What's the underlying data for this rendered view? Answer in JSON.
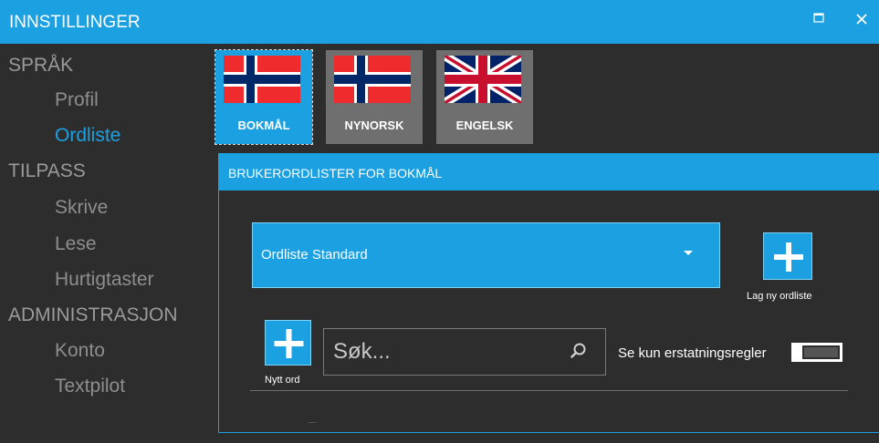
{
  "window": {
    "title": "INNSTILLINGER",
    "controls": [
      "maximize-icon",
      "close-icon"
    ]
  },
  "sidebar": {
    "sections": [
      {
        "label": "SPRÅK",
        "items": [
          {
            "label": "Profil",
            "active": false
          },
          {
            "label": "Ordliste",
            "active": true
          }
        ]
      },
      {
        "label": "TILPASS",
        "items": [
          {
            "label": "Skrive",
            "active": false
          },
          {
            "label": "Lese",
            "active": false
          },
          {
            "label": "Hurtigtaster",
            "active": false
          }
        ]
      },
      {
        "label": "ADMINISTRASJON",
        "items": [
          {
            "label": "Konto",
            "active": false
          },
          {
            "label": "Textpilot",
            "active": false
          }
        ]
      }
    ]
  },
  "languages": [
    {
      "label": "BOKMÅL",
      "flag": "norway-flag-icon",
      "selected": true
    },
    {
      "label": "NYNORSK",
      "flag": "norway-flag-icon",
      "selected": false
    },
    {
      "label": "ENGELSK",
      "flag": "uk-flag-icon",
      "selected": false
    }
  ],
  "panel": {
    "header": "BRUKERORDLISTER FOR BOKMÅL",
    "dropdown_value": "Ordliste Standard",
    "new_list_label": "Lag ny ordliste",
    "new_word_label": "Nytt ord",
    "search_placeholder": "Søk...",
    "toggle_label": "Se kun erstatningsregler",
    "toggle_on": false
  },
  "colors": {
    "accent": "#1ba1e2",
    "background": "#2d2d2d",
    "tile_inactive": "#6f6f6f",
    "nav_text": "#8e8e8e"
  }
}
